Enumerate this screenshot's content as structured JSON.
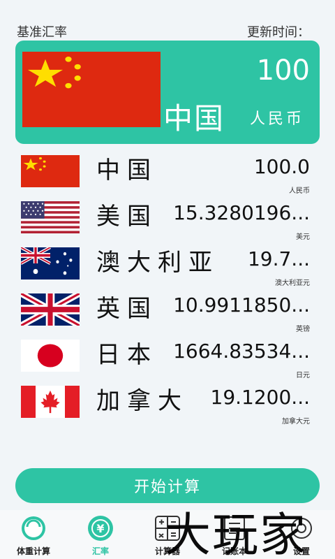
{
  "header": {
    "base_label": "基准汇率",
    "update_label": "更新时间："
  },
  "base": {
    "flag": "china-flag-icon",
    "amount": "100",
    "name": "中国",
    "unit": "人民币"
  },
  "rows": [
    {
      "flag": "china-flag-icon",
      "name": "中国",
      "rate": "100.0",
      "unit": "人民币"
    },
    {
      "flag": "usa-flag-icon",
      "name": "美国",
      "rate": "15.3280196...",
      "unit": "美元"
    },
    {
      "flag": "australia-flag-icon",
      "name": "澳大利亚",
      "rate": "19.7...",
      "unit": "澳大利亚元"
    },
    {
      "flag": "uk-flag-icon",
      "name": "英国",
      "rate": "10.9911850...",
      "unit": "英镑"
    },
    {
      "flag": "japan-flag-icon",
      "name": "日本",
      "rate": "1664.83534...",
      "unit": "日元"
    },
    {
      "flag": "canada-flag-icon",
      "name": "加拿大",
      "rate": "19.1200...",
      "unit": "加拿大元"
    }
  ],
  "calc_button": "开始计算",
  "tabs": [
    {
      "label": "体重计算",
      "icon": "scale-icon",
      "active": false
    },
    {
      "label": "汇率",
      "icon": "yuan-exchange-icon",
      "active": true
    },
    {
      "label": "计算器",
      "icon": "calculator-icon",
      "active": false
    },
    {
      "label": "记账本",
      "icon": "notebook-icon",
      "active": false
    },
    {
      "label": "设置",
      "icon": "settings-icon",
      "active": false
    }
  ],
  "colors": {
    "accent": "#2ec4a4",
    "background": "#f1f5f8"
  },
  "watermark": "大玩家"
}
